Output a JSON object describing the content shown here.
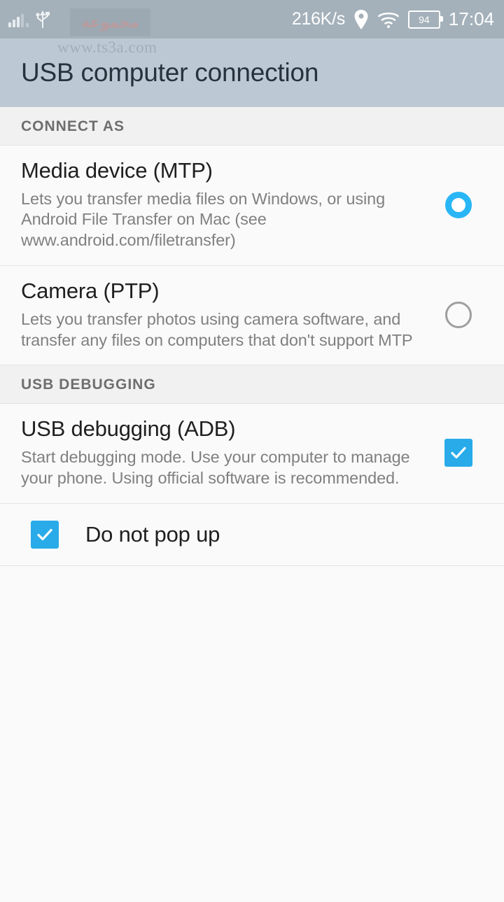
{
  "statusbar": {
    "signal_icon": "signal-bars-icon",
    "usb_icon": "usb-icon",
    "network_speed": "216K/s",
    "location_icon": "location-pin-icon",
    "wifi_icon": "wifi-icon",
    "battery_level": "94",
    "time": "17:04"
  },
  "watermark": {
    "badge_text": "مجموعة",
    "url": "www.ts3a.com"
  },
  "header": {
    "title": "USB computer connection"
  },
  "sections": [
    {
      "label": "CONNECT AS",
      "rows": [
        {
          "title": "Media device (MTP)",
          "subtitle": "Lets you transfer media files on Windows, or using Android File Transfer on Mac (see www.android.com/filetransfer)",
          "control": "radio",
          "checked": true
        },
        {
          "title": "Camera (PTP)",
          "subtitle": "Lets you transfer photos using camera software, and transfer any files on computers that don't support MTP",
          "control": "radio",
          "checked": false
        }
      ]
    },
    {
      "label": "USB DEBUGGING",
      "rows": [
        {
          "title": "USB debugging (ADB)",
          "subtitle": "Start debugging mode. Use your computer to manage your phone. Using official software is recommended.",
          "control": "checkbox",
          "checked": true
        }
      ]
    }
  ],
  "popup_row": {
    "label": "Do not pop up",
    "control": "checkbox",
    "checked": true
  },
  "colors": {
    "statusbar_bg": "#a4b1ba",
    "appbar_bg": "#bcc9d4",
    "accent": "#29abe9",
    "radio_on": "#29b6f6",
    "list_bg": "#fafafa",
    "section_bg": "#f1f1f1",
    "title_text": "#1f1f1f",
    "subtitle_text": "#808080"
  }
}
